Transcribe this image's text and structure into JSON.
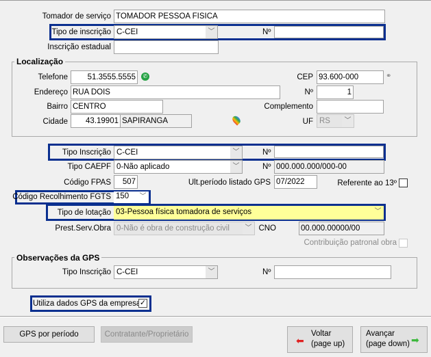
{
  "tomador": {
    "label": "Tomador de serviço",
    "value": "TOMADOR PESSOA FISICA"
  },
  "tipo_inscricao_top": {
    "label": "Tipo de inscrição",
    "value": "C-CEI",
    "num_label": "Nº",
    "num_value": ""
  },
  "inscricao_estadual": {
    "label": "Inscrição estadual",
    "value": ""
  },
  "localizacao": {
    "title": "Localização",
    "telefone": {
      "label": "Telefone",
      "value": "51.3555.5555"
    },
    "cep": {
      "label": "CEP",
      "value": "93.600-000"
    },
    "endereco": {
      "label": "Endereço",
      "value": "RUA DOIS"
    },
    "numero": {
      "label": "Nº",
      "value": "1"
    },
    "bairro": {
      "label": "Bairro",
      "value": "CENTRO"
    },
    "complemento": {
      "label": "Complemento",
      "value": ""
    },
    "cidade": {
      "label": "Cidade",
      "code": "43.19901",
      "name": "SAPIRANGA"
    },
    "uf": {
      "label": "UF",
      "value": "RS"
    }
  },
  "gps": {
    "tipo_inscricao": {
      "label": "Tipo Inscrição",
      "value": "C-CEI",
      "num_label": "Nº",
      "num_value": ""
    },
    "tipo_caepf": {
      "label": "Tipo CAEPF",
      "value": "0-Não aplicado",
      "num_label": "Nº",
      "num_value": "000.000.000/000-00"
    },
    "codigo_fpas": {
      "label": "Código FPAS",
      "value": "507"
    },
    "ult_periodo": {
      "label": "Ult.período listado GPS",
      "value": "07/2022"
    },
    "referente_13": {
      "label": "Referente ao 13º",
      "checked": false
    },
    "codigo_fgts": {
      "label": "Código Recolhimento FGTS",
      "value": "150"
    },
    "tipo_lotacao": {
      "label": "Tipo de lotação",
      "value": "03-Pessoa física tomadora de serviços"
    },
    "prest_serv_obra": {
      "label": "Prest.Serv.Obra",
      "value": "0-Não é obra de construção civil"
    },
    "cno": {
      "label": "CNO",
      "value": "00.000.00000/00"
    },
    "contribuicao_patronal": {
      "label": "Contribuição patronal obra",
      "checked": false
    }
  },
  "observacoes": {
    "title": "Observações da GPS",
    "tipo_inscricao": {
      "label": "Tipo Inscrição",
      "value": "C-CEI",
      "num_label": "Nº",
      "num_value": ""
    }
  },
  "utiliza_dados": {
    "label": "Utiliza dados GPS da empresa",
    "checked": true,
    "mark": "✓"
  },
  "buttons": {
    "gps_periodo": "GPS por período",
    "contratante": "Contratante/Proprietário",
    "voltar": "Voltar",
    "voltar_sub": "(page up)",
    "avancar": "Avançar",
    "avancar_sub": "(page down)"
  },
  "colors": {
    "highlight": "#0a2f8f",
    "yellow": "#ffff99"
  }
}
